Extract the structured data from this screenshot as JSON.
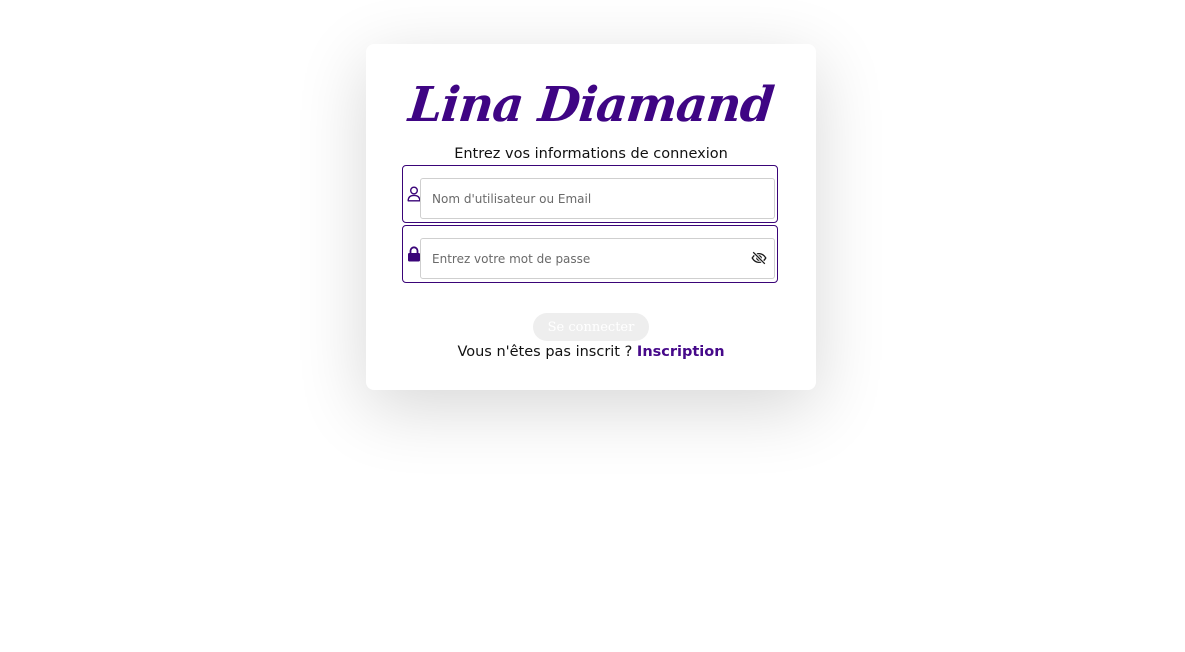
{
  "brand": {
    "name": "Lina Diamand",
    "color": "#3f0584"
  },
  "login": {
    "subtitle": "Entrez vos informations de connexion",
    "username": {
      "placeholder": "Nom d'utilisateur ou Email",
      "value": "",
      "icon": "user-icon"
    },
    "password": {
      "placeholder": "Entrez votre mot de passe",
      "value": "",
      "icon": "lock-icon",
      "toggle_icon": "eye-off-icon"
    },
    "submit_label": "Se connecter",
    "signup_prompt": "Vous n'êtes pas inscrit ? ",
    "signup_link": "Inscription"
  },
  "colors": {
    "accent": "#3f0584",
    "border": "#3a0478",
    "button_bg": "#eeeeee"
  }
}
